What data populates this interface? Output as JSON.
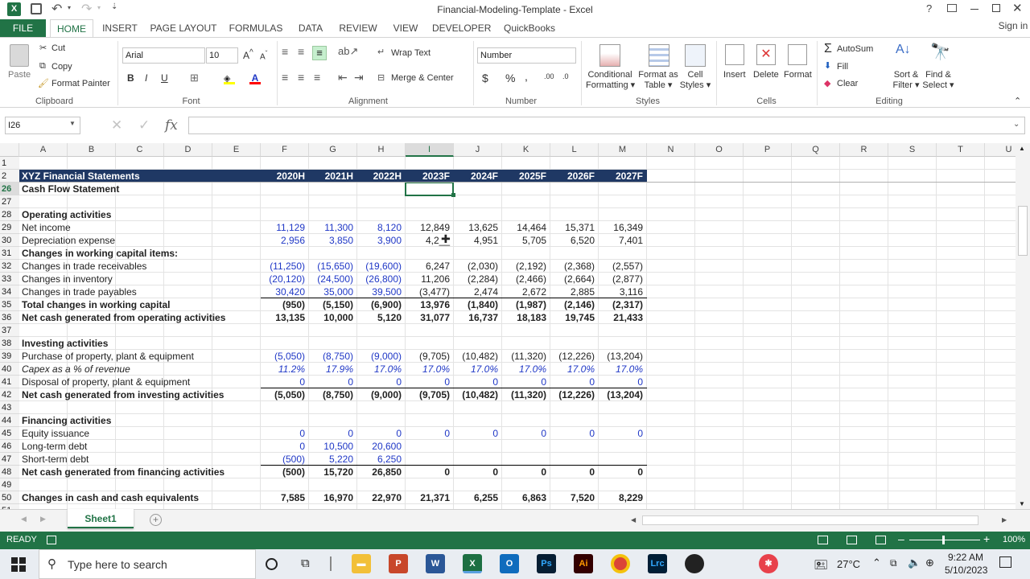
{
  "window": {
    "title": "Financial-Modeling-Template - Excel",
    "help": "?",
    "sign_in": "Sign in"
  },
  "tabs": [
    "FILE",
    "HOME",
    "INSERT",
    "PAGE LAYOUT",
    "FORMULAS",
    "DATA",
    "REVIEW",
    "VIEW",
    "DEVELOPER",
    "QuickBooks"
  ],
  "ribbon": {
    "clipboard": {
      "paste": "Paste",
      "cut": "Cut",
      "copy": "Copy",
      "format_painter": "Format Painter",
      "label": "Clipboard"
    },
    "font": {
      "name": "Arial",
      "size": "10",
      "label": "Font",
      "bold": "B",
      "italic": "I",
      "underline": "U"
    },
    "alignment": {
      "wrap": "Wrap Text",
      "merge": "Merge & Center",
      "label": "Alignment"
    },
    "number": {
      "format": "Number",
      "currency": "$",
      "percent": "%",
      "comma": ",",
      "label": "Number"
    },
    "styles": {
      "conditional": "Conditional",
      "conditional2": "Formatting",
      "format_as": "Format as",
      "format_as2": "Table",
      "cell": "Cell",
      "cell2": "Styles",
      "label": "Styles"
    },
    "cells": {
      "insert": "Insert",
      "delete": "Delete",
      "format": "Format",
      "label": "Cells"
    },
    "editing": {
      "autosum": "AutoSum",
      "fill": "Fill",
      "clear": "Clear",
      "sort": "Sort &",
      "sort2": "Filter",
      "find": "Find &",
      "find2": "Select",
      "label": "Editing"
    }
  },
  "formula_bar": {
    "name_box": "I26",
    "fx": "fx",
    "content": ""
  },
  "columns": [
    "A",
    "B",
    "C",
    "D",
    "E",
    "F",
    "G",
    "H",
    "I",
    "J",
    "K",
    "L",
    "M",
    "N",
    "O",
    "P",
    "Q",
    "R",
    "S",
    "T",
    "U"
  ],
  "header_row": {
    "row": "2",
    "title": "XYZ Financial Statements",
    "years": [
      "2020H",
      "2021H",
      "2022H",
      "2023F",
      "2024F",
      "2025F",
      "2026F",
      "2027F"
    ]
  },
  "rows": [
    {
      "n": "1",
      "label": "",
      "vals": [],
      "style": ""
    },
    {
      "n": "26",
      "label": "Cash Flow Statement",
      "vals": [],
      "style": "bold"
    },
    {
      "n": "27",
      "label": "",
      "vals": [],
      "style": ""
    },
    {
      "n": "28",
      "label": "Operating activities",
      "vals": [],
      "style": "bold"
    },
    {
      "n": "29",
      "label": "Net income",
      "vals": [
        "11,129",
        "11,300",
        "8,120",
        "12,849",
        "13,625",
        "14,464",
        "15,371",
        "16,349"
      ],
      "style": "",
      "blue": 3
    },
    {
      "n": "30",
      "label": "Depreciation expense",
      "vals": [
        "2,956",
        "3,850",
        "3,900",
        "4,2__",
        "4,951",
        "5,705",
        "6,520",
        "7,401"
      ],
      "style": "",
      "blue": 3
    },
    {
      "n": "31",
      "label": "Changes in working capital items:",
      "vals": [],
      "style": "bold"
    },
    {
      "n": "32",
      "label": "Changes in trade receivables",
      "vals": [
        "(11,250)",
        "(15,650)",
        "(19,600)",
        "6,247",
        "(2,030)",
        "(2,192)",
        "(2,368)",
        "(2,557)"
      ],
      "style": "",
      "blue": 3
    },
    {
      "n": "33",
      "label": "Changes in inventory",
      "vals": [
        "(20,120)",
        "(24,500)",
        "(26,800)",
        "11,206",
        "(2,284)",
        "(2,466)",
        "(2,664)",
        "(2,877)"
      ],
      "style": "",
      "blue": 3
    },
    {
      "n": "34",
      "label": "Changes in trade payables",
      "vals": [
        "30,420",
        "35,000",
        "39,500",
        "(3,477)",
        "2,474",
        "2,672",
        "2,885",
        "3,116"
      ],
      "style": "",
      "blue": 3
    },
    {
      "n": "35",
      "label": "Total changes in working capital",
      "vals": [
        "(950)",
        "(5,150)",
        "(6,900)",
        "13,976",
        "(1,840)",
        "(1,987)",
        "(2,146)",
        "(2,317)"
      ],
      "style": "bold",
      "topline": true
    },
    {
      "n": "36",
      "label": "Net cash generated from operating activities",
      "vals": [
        "13,135",
        "10,000",
        "5,120",
        "31,077",
        "16,737",
        "18,183",
        "19,745",
        "21,433"
      ],
      "style": "bold"
    },
    {
      "n": "37",
      "label": "",
      "vals": [],
      "style": ""
    },
    {
      "n": "38",
      "label": "Investing activities",
      "vals": [],
      "style": "bold"
    },
    {
      "n": "39",
      "label": "Purchase of property, plant & equipment",
      "vals": [
        "(5,050)",
        "(8,750)",
        "(9,000)",
        "(9,705)",
        "(10,482)",
        "(11,320)",
        "(12,226)",
        "(13,204)"
      ],
      "style": "",
      "blue": 3
    },
    {
      "n": "40",
      "label": "Capex as a % of revenue",
      "vals": [
        "11.2%",
        "17.9%",
        "17.0%",
        "17.0%",
        "17.0%",
        "17.0%",
        "17.0%",
        "17.0%"
      ],
      "style": "ital",
      "blue": 8
    },
    {
      "n": "41",
      "label": "Disposal of property, plant & equipment",
      "vals": [
        "0",
        "0",
        "0",
        "0",
        "0",
        "0",
        "0",
        "0"
      ],
      "style": "",
      "blue": 8
    },
    {
      "n": "42",
      "label": "Net cash generated from investing activities",
      "vals": [
        "(5,050)",
        "(8,750)",
        "(9,000)",
        "(9,705)",
        "(10,482)",
        "(11,320)",
        "(12,226)",
        "(13,204)"
      ],
      "style": "bold",
      "topline": true
    },
    {
      "n": "43",
      "label": "",
      "vals": [],
      "style": ""
    },
    {
      "n": "44",
      "label": "Financing activities",
      "vals": [],
      "style": "bold"
    },
    {
      "n": "45",
      "label": "Equity issuance",
      "vals": [
        "0",
        "0",
        "0",
        "0",
        "0",
        "0",
        "0",
        "0"
      ],
      "style": "",
      "blue": 8
    },
    {
      "n": "46",
      "label": "Long-term debt",
      "vals": [
        "0",
        "10,500",
        "20,600",
        "",
        "",
        "",
        "",
        ""
      ],
      "style": "",
      "blue": 3
    },
    {
      "n": "47",
      "label": "Short-term debt",
      "vals": [
        "(500)",
        "5,220",
        "6,250",
        "",
        "",
        "",
        "",
        ""
      ],
      "style": "",
      "blue": 3
    },
    {
      "n": "48",
      "label": "Net cash generated from financing activities",
      "vals": [
        "(500)",
        "15,720",
        "26,850",
        "0",
        "0",
        "0",
        "0",
        "0"
      ],
      "style": "bold",
      "topline": true
    },
    {
      "n": "49",
      "label": "",
      "vals": [],
      "style": ""
    },
    {
      "n": "50",
      "label": "Changes in cash and cash equivalents",
      "vals": [
        "7,585",
        "16,970",
        "22,970",
        "21,371",
        "6,255",
        "6,863",
        "7,520",
        "8,229"
      ],
      "style": "bold"
    },
    {
      "n": "51",
      "label": "",
      "vals": [],
      "style": ""
    }
  ],
  "sheet_tab": "Sheet1",
  "status": {
    "ready": "READY",
    "zoom": "100%"
  },
  "taskbar": {
    "search_placeholder": "Type here to search",
    "temp": "27°C",
    "time": "9:22 AM",
    "date": "5/10/2023"
  },
  "colors": {
    "excel_green": "#217346",
    "header_navy": "#1f3864",
    "input_blue": "#1f37c6"
  }
}
